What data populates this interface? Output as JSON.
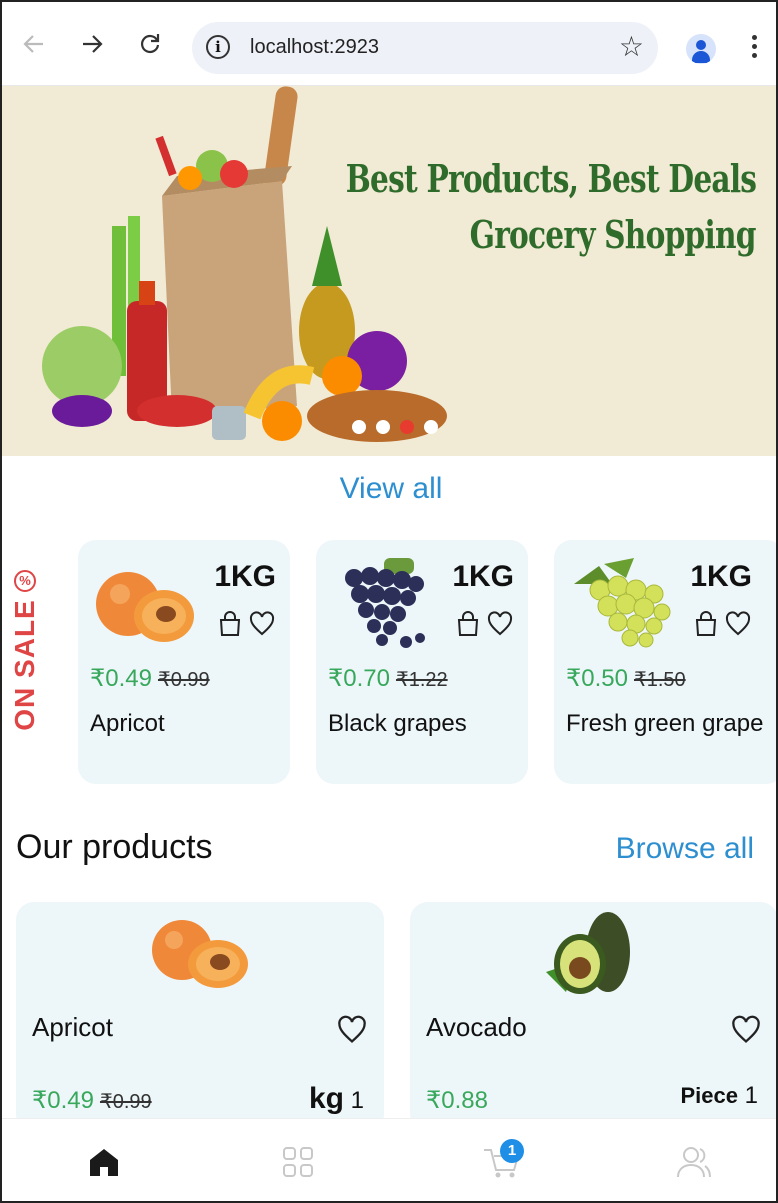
{
  "browser": {
    "url": "localhost:2923"
  },
  "banner": {
    "line1": "Best Products, Best Deals",
    "line2": "Grocery Shopping",
    "slide_count": 4,
    "active_slide": 3
  },
  "view_all_label": "View all",
  "on_sale": {
    "label": "ON SALE",
    "items": [
      {
        "weight": "1KG",
        "price": "₹0.49",
        "old_price": "₹0.99",
        "name": "Apricot"
      },
      {
        "weight": "1KG",
        "price": "₹0.70",
        "old_price": "₹1.22",
        "name": "Black grapes"
      },
      {
        "weight": "1KG",
        "price": "₹0.50",
        "old_price": "₹1.50",
        "name": "Fresh green grape"
      }
    ]
  },
  "products": {
    "title": "Our products",
    "browse_label": "Browse all",
    "items": [
      {
        "name": "Apricot",
        "price": "₹0.49",
        "old_price": "₹0.99",
        "unit": "kg",
        "qty": "1"
      },
      {
        "name": "Avocado",
        "price": "₹0.88",
        "old_price": "",
        "unit": "Piece",
        "qty": "1"
      }
    ]
  },
  "nav": {
    "cart_count": "1",
    "items": [
      "home-icon",
      "grid-icon",
      "cart-icon",
      "users-icon"
    ]
  },
  "colors": {
    "accent_blue": "#2d8fd0",
    "price_green": "#38a85c",
    "sale_red": "#e04545",
    "banner_green": "#2f6b2a",
    "card_bg": "#edf6f8"
  }
}
